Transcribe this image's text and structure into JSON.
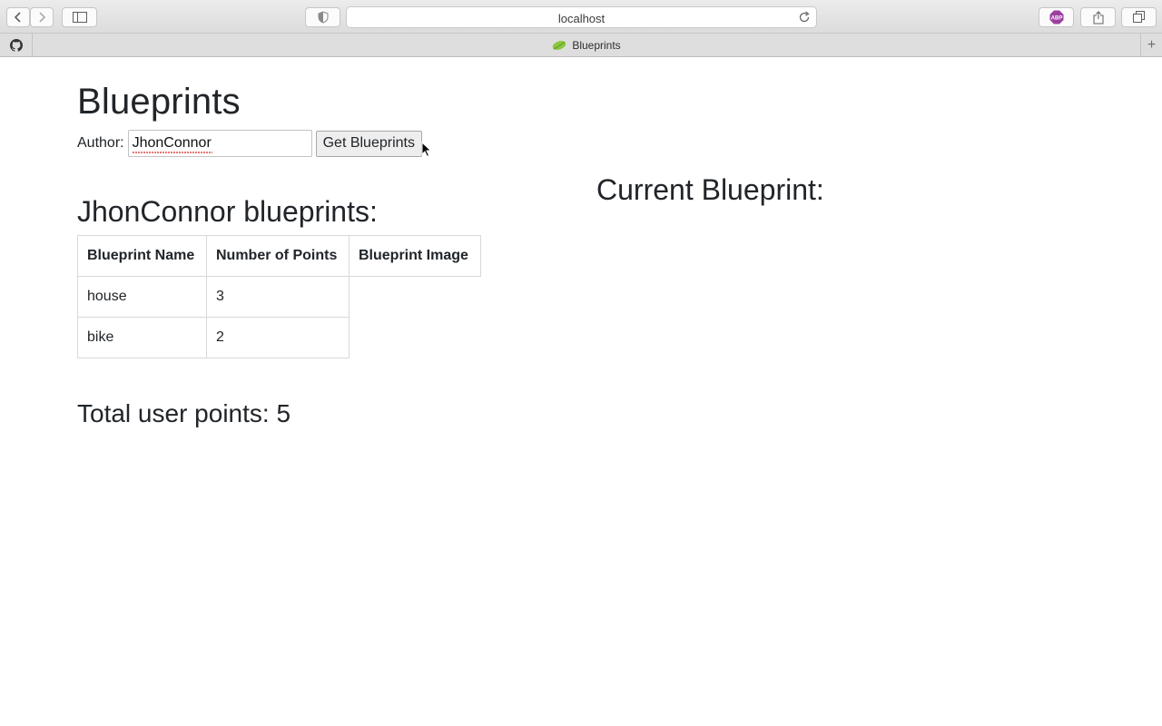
{
  "browser": {
    "url": "localhost",
    "tab_title": "Blueprints",
    "new_tab_symbol": "+",
    "icons": [
      "back-icon",
      "forward-icon",
      "sidebar-icon",
      "shield-icon",
      "reload-icon",
      "adblock-icon",
      "share-icon",
      "tabs-overview-icon",
      "github-icon",
      "spring-leaf-icon"
    ],
    "adblock_badge": "ABP",
    "adblock_color": "#9c3fa0"
  },
  "page": {
    "title": "Blueprints",
    "author_label": "Author:",
    "author_value": "JhonConnor",
    "get_button": "Get Blueprints",
    "blueprints_heading": "JhonConnor blueprints:",
    "current_heading": "Current Blueprint:",
    "table": {
      "headers": [
        "Blueprint Name",
        "Number of Points",
        "Blueprint Image"
      ],
      "rows": [
        {
          "name": "house",
          "points": "3"
        },
        {
          "name": "bike",
          "points": "2"
        }
      ]
    },
    "total_points": "Total user points: 5"
  }
}
